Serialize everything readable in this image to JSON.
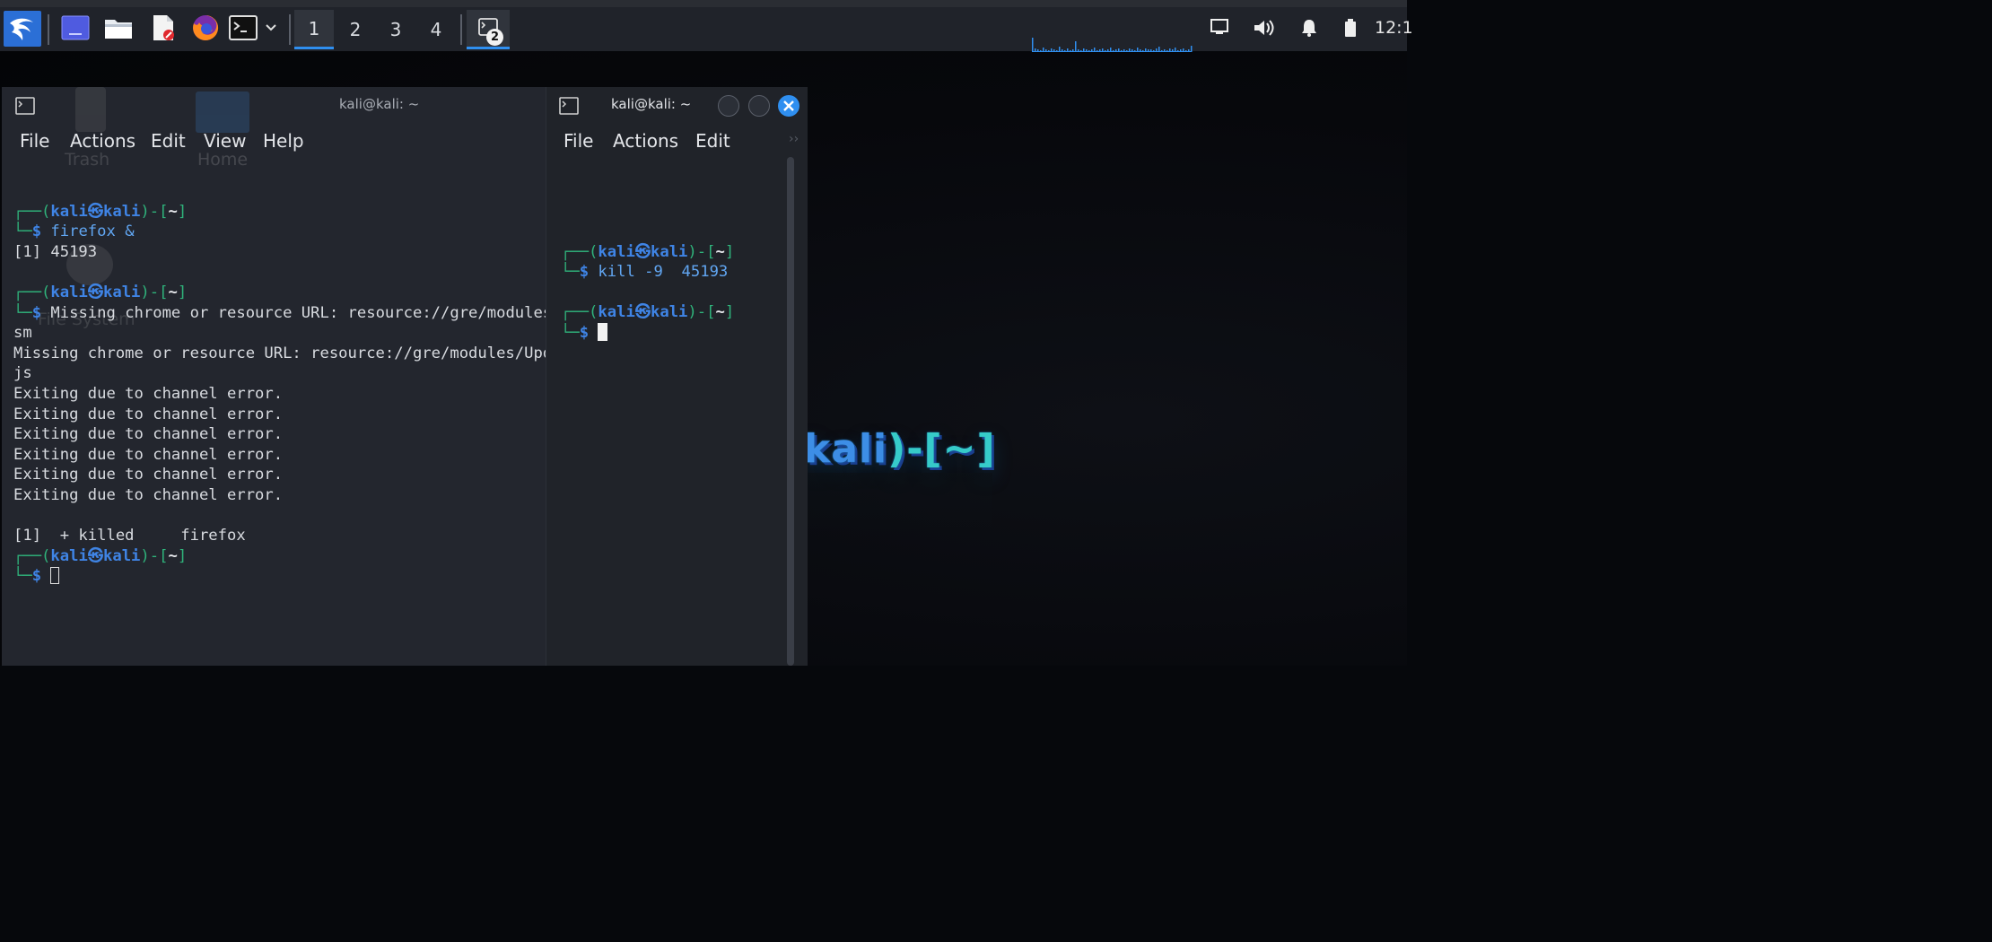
{
  "panel": {
    "workspaces": [
      "1",
      "2",
      "3",
      "4"
    ],
    "active_workspace": "1",
    "task_badge": "2",
    "clock": "12:1"
  },
  "left_terminal": {
    "title": "kali@kali: ~",
    "menu": [
      "File",
      "Actions",
      "Edit",
      "View",
      "Help"
    ],
    "prompt_user": "kali",
    "prompt_at": "㉿",
    "prompt_host": "kali",
    "prompt_dir": "~",
    "cmd1": "firefox &",
    "out_job": "[1] 45193",
    "cmd2": "Missing chrome or resource URL: resource://gre/modules/UpdateListener.sys.mjs",
    "cmd2_wrap": "sm",
    "missing_line": "Missing chrome or resource URL: resource://gre/modules/UpdateListener.sys.m",
    "missing_wrap": "js",
    "exit_line": "Exiting due to channel error.",
    "killed_line": "[1]  + killed     firefox"
  },
  "right_terminal": {
    "title": "kali@kali: ~",
    "menu": [
      "File",
      "Actions",
      "Edit"
    ],
    "overflow": "››",
    "cmd1": "kill -9  45193"
  },
  "desktop": {
    "icons": [
      "Trash",
      "Home",
      "File System"
    ],
    "wallpaper_text_host": "kali",
    "wallpaper_text_rest": ")-[~]"
  },
  "colors": {
    "accent": "#2f8ff0",
    "prompt_green": "#2fb37b",
    "prompt_blue": "#3f84e5"
  }
}
